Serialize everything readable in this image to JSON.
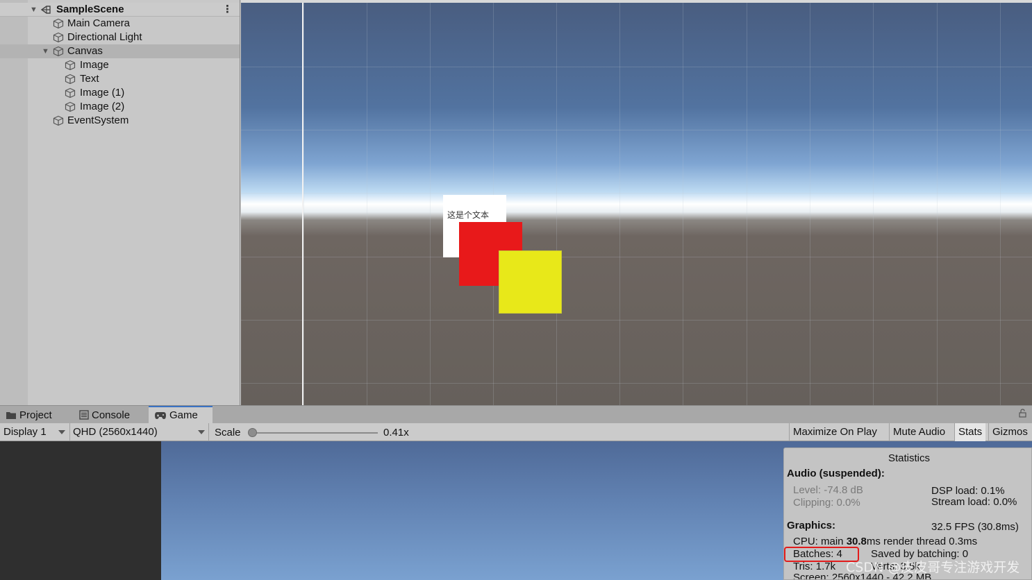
{
  "hierarchy": {
    "scene_name": "SampleScene",
    "items": [
      {
        "label": "Main Camera"
      },
      {
        "label": "Directional Light"
      },
      {
        "label": "Canvas"
      },
      {
        "label": "Image"
      },
      {
        "label": "Text"
      },
      {
        "label": "Image (1)"
      },
      {
        "label": "Image (2)"
      },
      {
        "label": "EventSystem"
      }
    ],
    "menu_glyph": "⋮"
  },
  "scene_view": {
    "text_object": "这是个文本",
    "colors": {
      "white_image": "#ffffff",
      "red_image": "#e8191a",
      "yellow_image": "#e8e819"
    }
  },
  "tabs": {
    "project": "Project",
    "console": "Console",
    "game": "Game"
  },
  "game_toolbar": {
    "display": "Display 1",
    "resolution": "QHD (2560x1440)",
    "scale_label": "Scale",
    "scale_value": "0.41x",
    "maximize_on_play": "Maximize On Play",
    "mute_audio": "Mute Audio",
    "stats": "Stats",
    "gizmos": "Gizmos"
  },
  "statistics": {
    "title": "Statistics",
    "audio_header": "Audio (suspended):",
    "level": "Level: -74.8 dB",
    "clipping": "Clipping: 0.0%",
    "dsp_load": "DSP load: 0.1%",
    "stream_load": "Stream load: 0.0%",
    "graphics_header": "Graphics:",
    "fps": "32.5 FPS (30.8ms)",
    "cpu_prefix": "CPU: main ",
    "cpu_main": "30.8",
    "cpu_suffix": "ms  render thread 0.3ms",
    "batches": "Batches: 4",
    "saved_by_batching": "Saved by batching: 0",
    "tris": "Tris: 1.7k",
    "verts": "Verts: 3.5k",
    "screen": "Screen: 2560x1440 - 42.2 MB"
  },
  "watermark": "CSDN @皮皮哥专注游戏开发"
}
